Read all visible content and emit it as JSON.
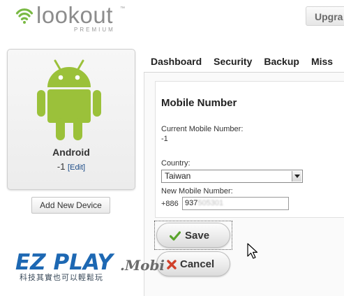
{
  "header": {
    "logo_text": "lookout",
    "logo_tm": "™",
    "logo_sub": "PREMIUM",
    "upgrade_label": "Upgra"
  },
  "device": {
    "name": "Android",
    "number": "-1",
    "edit_label": "[Edit]",
    "add_device_label": "Add New Device"
  },
  "nav": {
    "tabs": [
      "Dashboard",
      "Security",
      "Backup",
      "Miss"
    ]
  },
  "mobile_form": {
    "title": "Mobile Number",
    "current_label": "Current Mobile Number:",
    "current_value": "-1",
    "country_label": "Country:",
    "country_selected": "Taiwan",
    "new_label": "New Mobile Number:",
    "prefix": "+886",
    "phone_visible": "937",
    "phone_blurred": "505301",
    "save_label": "Save",
    "cancel_label": "Cancel"
  },
  "watermark": {
    "brand": "EZ PLAY",
    "brand_suffix": ".Mobi",
    "tagline": "科技其實也可以輕鬆玩"
  },
  "colors": {
    "android_green": "#9bc13a",
    "lookout_green": "#79b943",
    "save_check": "#5aa42c",
    "cancel_x": "#d0402a",
    "watermark_blue": "#1d68b3"
  }
}
